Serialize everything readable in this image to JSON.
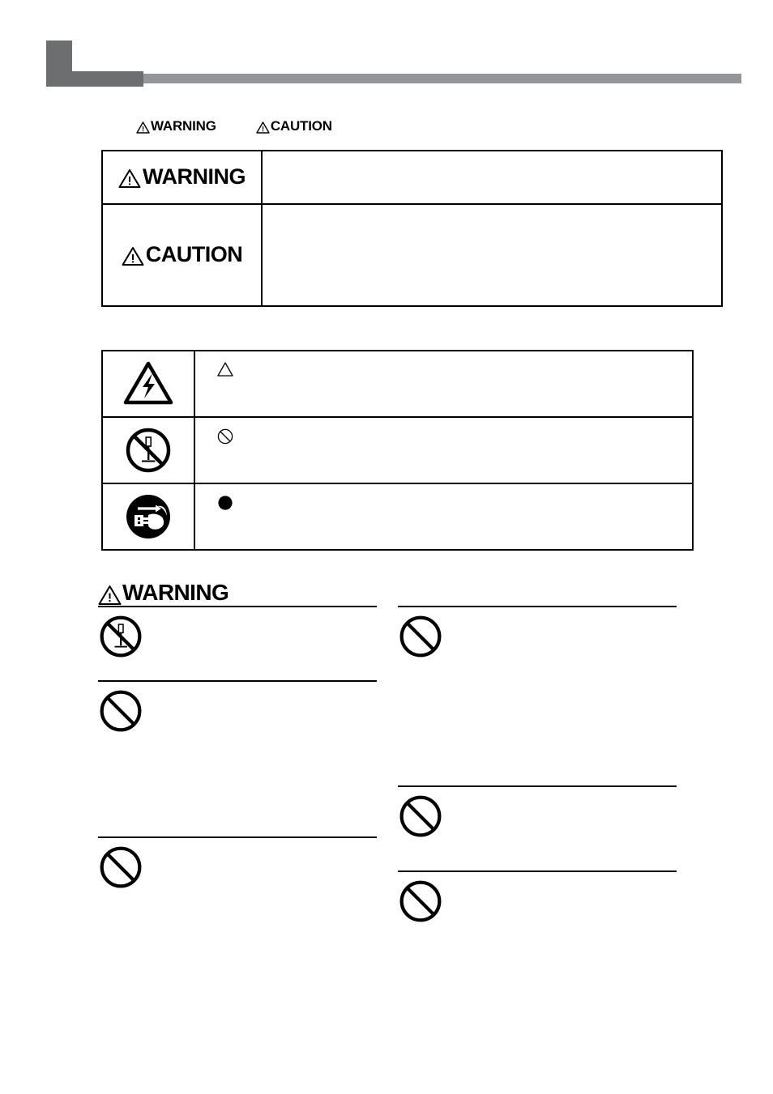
{
  "page": {
    "background_color": "#ffffff",
    "header_dark_color": "#6d6e70",
    "header_light_color": "#939598"
  },
  "header": {
    "block_icon": "corner-block-decoration",
    "rule_icon": "horizontal-rule-decoration"
  },
  "term_legend": {
    "warning_label": "WARNING",
    "caution_label": "CAUTION",
    "warning_icon": "warning-triangle-icon",
    "caution_icon": "warning-triangle-icon"
  },
  "definition_table": {
    "name": "safety-term-definition-table",
    "rows": [
      {
        "term": "WARNING",
        "term_icon": "warning-triangle-icon",
        "description": ""
      },
      {
        "term": "CAUTION",
        "term_icon": "warning-triangle-icon",
        "description": ""
      }
    ]
  },
  "symbol_table": {
    "name": "safety-symbol-meaning-table",
    "rows": [
      {
        "symbol_icon": "electric-shock-triangle-icon",
        "mark_icon": "outline-triangle-mark",
        "meaning": ""
      },
      {
        "symbol_icon": "no-disassembly-screwdriver-icon",
        "mark_icon": "prohibition-circle-mark",
        "meaning": ""
      },
      {
        "symbol_icon": "unplug-power-cord-icon",
        "mark_icon": "filled-circle-mark",
        "meaning": ""
      }
    ]
  },
  "warning_section": {
    "heading": "WARNING",
    "heading_icon": "warning-triangle-icon",
    "left_column": [
      {
        "icon": "no-disassembly-screwdriver-icon",
        "text": ""
      },
      {
        "icon": "prohibition-circle-icon",
        "text": ""
      },
      {
        "icon": "prohibition-circle-icon",
        "text": ""
      }
    ],
    "right_column": [
      {
        "icon": "prohibition-circle-icon",
        "text": ""
      },
      {
        "icon": "prohibition-circle-icon",
        "text": ""
      },
      {
        "icon": "prohibition-circle-icon",
        "text": ""
      }
    ]
  }
}
